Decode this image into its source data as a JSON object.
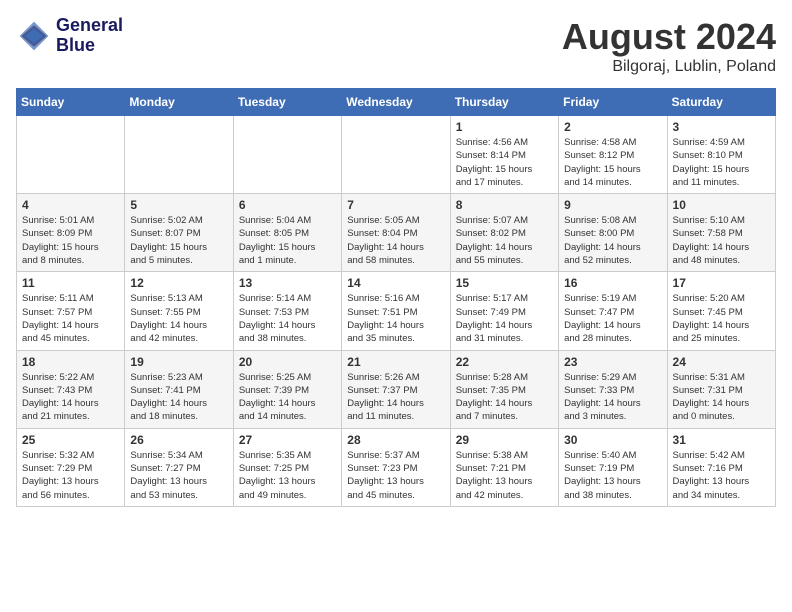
{
  "header": {
    "logo_line1": "General",
    "logo_line2": "Blue",
    "month": "August 2024",
    "location": "Bilgoraj, Lublin, Poland"
  },
  "weekdays": [
    "Sunday",
    "Monday",
    "Tuesday",
    "Wednesday",
    "Thursday",
    "Friday",
    "Saturday"
  ],
  "weeks": [
    [
      {
        "day": "",
        "info": ""
      },
      {
        "day": "",
        "info": ""
      },
      {
        "day": "",
        "info": ""
      },
      {
        "day": "",
        "info": ""
      },
      {
        "day": "1",
        "info": "Sunrise: 4:56 AM\nSunset: 8:14 PM\nDaylight: 15 hours\nand 17 minutes."
      },
      {
        "day": "2",
        "info": "Sunrise: 4:58 AM\nSunset: 8:12 PM\nDaylight: 15 hours\nand 14 minutes."
      },
      {
        "day": "3",
        "info": "Sunrise: 4:59 AM\nSunset: 8:10 PM\nDaylight: 15 hours\nand 11 minutes."
      }
    ],
    [
      {
        "day": "4",
        "info": "Sunrise: 5:01 AM\nSunset: 8:09 PM\nDaylight: 15 hours\nand 8 minutes."
      },
      {
        "day": "5",
        "info": "Sunrise: 5:02 AM\nSunset: 8:07 PM\nDaylight: 15 hours\nand 5 minutes."
      },
      {
        "day": "6",
        "info": "Sunrise: 5:04 AM\nSunset: 8:05 PM\nDaylight: 15 hours\nand 1 minute."
      },
      {
        "day": "7",
        "info": "Sunrise: 5:05 AM\nSunset: 8:04 PM\nDaylight: 14 hours\nand 58 minutes."
      },
      {
        "day": "8",
        "info": "Sunrise: 5:07 AM\nSunset: 8:02 PM\nDaylight: 14 hours\nand 55 minutes."
      },
      {
        "day": "9",
        "info": "Sunrise: 5:08 AM\nSunset: 8:00 PM\nDaylight: 14 hours\nand 52 minutes."
      },
      {
        "day": "10",
        "info": "Sunrise: 5:10 AM\nSunset: 7:58 PM\nDaylight: 14 hours\nand 48 minutes."
      }
    ],
    [
      {
        "day": "11",
        "info": "Sunrise: 5:11 AM\nSunset: 7:57 PM\nDaylight: 14 hours\nand 45 minutes."
      },
      {
        "day": "12",
        "info": "Sunrise: 5:13 AM\nSunset: 7:55 PM\nDaylight: 14 hours\nand 42 minutes."
      },
      {
        "day": "13",
        "info": "Sunrise: 5:14 AM\nSunset: 7:53 PM\nDaylight: 14 hours\nand 38 minutes."
      },
      {
        "day": "14",
        "info": "Sunrise: 5:16 AM\nSunset: 7:51 PM\nDaylight: 14 hours\nand 35 minutes."
      },
      {
        "day": "15",
        "info": "Sunrise: 5:17 AM\nSunset: 7:49 PM\nDaylight: 14 hours\nand 31 minutes."
      },
      {
        "day": "16",
        "info": "Sunrise: 5:19 AM\nSunset: 7:47 PM\nDaylight: 14 hours\nand 28 minutes."
      },
      {
        "day": "17",
        "info": "Sunrise: 5:20 AM\nSunset: 7:45 PM\nDaylight: 14 hours\nand 25 minutes."
      }
    ],
    [
      {
        "day": "18",
        "info": "Sunrise: 5:22 AM\nSunset: 7:43 PM\nDaylight: 14 hours\nand 21 minutes."
      },
      {
        "day": "19",
        "info": "Sunrise: 5:23 AM\nSunset: 7:41 PM\nDaylight: 14 hours\nand 18 minutes."
      },
      {
        "day": "20",
        "info": "Sunrise: 5:25 AM\nSunset: 7:39 PM\nDaylight: 14 hours\nand 14 minutes."
      },
      {
        "day": "21",
        "info": "Sunrise: 5:26 AM\nSunset: 7:37 PM\nDaylight: 14 hours\nand 11 minutes."
      },
      {
        "day": "22",
        "info": "Sunrise: 5:28 AM\nSunset: 7:35 PM\nDaylight: 14 hours\nand 7 minutes."
      },
      {
        "day": "23",
        "info": "Sunrise: 5:29 AM\nSunset: 7:33 PM\nDaylight: 14 hours\nand 3 minutes."
      },
      {
        "day": "24",
        "info": "Sunrise: 5:31 AM\nSunset: 7:31 PM\nDaylight: 14 hours\nand 0 minutes."
      }
    ],
    [
      {
        "day": "25",
        "info": "Sunrise: 5:32 AM\nSunset: 7:29 PM\nDaylight: 13 hours\nand 56 minutes."
      },
      {
        "day": "26",
        "info": "Sunrise: 5:34 AM\nSunset: 7:27 PM\nDaylight: 13 hours\nand 53 minutes."
      },
      {
        "day": "27",
        "info": "Sunrise: 5:35 AM\nSunset: 7:25 PM\nDaylight: 13 hours\nand 49 minutes."
      },
      {
        "day": "28",
        "info": "Sunrise: 5:37 AM\nSunset: 7:23 PM\nDaylight: 13 hours\nand 45 minutes."
      },
      {
        "day": "29",
        "info": "Sunrise: 5:38 AM\nSunset: 7:21 PM\nDaylight: 13 hours\nand 42 minutes."
      },
      {
        "day": "30",
        "info": "Sunrise: 5:40 AM\nSunset: 7:19 PM\nDaylight: 13 hours\nand 38 minutes."
      },
      {
        "day": "31",
        "info": "Sunrise: 5:42 AM\nSunset: 7:16 PM\nDaylight: 13 hours\nand 34 minutes."
      }
    ]
  ]
}
